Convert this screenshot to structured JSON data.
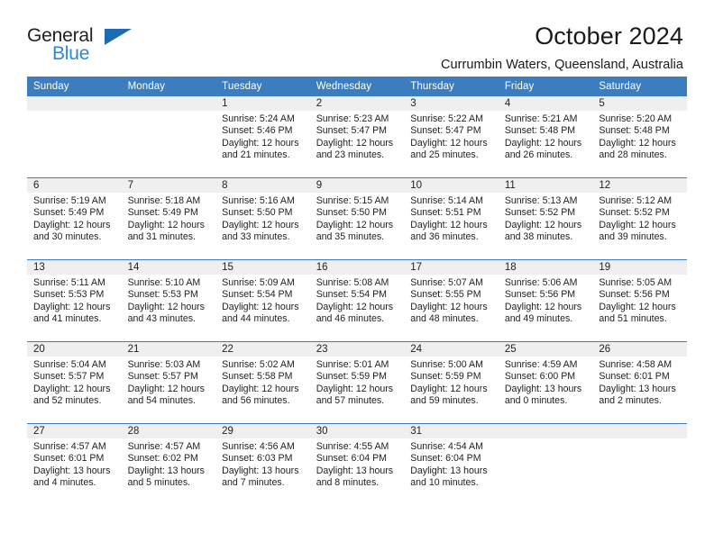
{
  "brand": {
    "name_part1": "General",
    "name_part2": "Blue",
    "triangle_icon": "triangle-icon",
    "accent_blue": "#2b8ad6",
    "dark_blue": "#1b6cb3"
  },
  "header": {
    "title": "October 2024",
    "subtitle": "Currumbin Waters, Queensland, Australia"
  },
  "theme": {
    "header_row_bg": "#3b7dbe",
    "day_band_bg": "#efefef",
    "grid_line": "#3b7dbe",
    "text": "#222222"
  },
  "weekday_headers": [
    "Sunday",
    "Monday",
    "Tuesday",
    "Wednesday",
    "Thursday",
    "Friday",
    "Saturday"
  ],
  "weeks": [
    [
      {
        "day": "",
        "sunrise": "",
        "sunset": "",
        "daylight_line1": "",
        "daylight_line2": ""
      },
      {
        "day": "",
        "sunrise": "",
        "sunset": "",
        "daylight_line1": "",
        "daylight_line2": ""
      },
      {
        "day": "1",
        "sunrise": "Sunrise: 5:24 AM",
        "sunset": "Sunset: 5:46 PM",
        "daylight_line1": "Daylight: 12 hours",
        "daylight_line2": "and 21 minutes."
      },
      {
        "day": "2",
        "sunrise": "Sunrise: 5:23 AM",
        "sunset": "Sunset: 5:47 PM",
        "daylight_line1": "Daylight: 12 hours",
        "daylight_line2": "and 23 minutes."
      },
      {
        "day": "3",
        "sunrise": "Sunrise: 5:22 AM",
        "sunset": "Sunset: 5:47 PM",
        "daylight_line1": "Daylight: 12 hours",
        "daylight_line2": "and 25 minutes."
      },
      {
        "day": "4",
        "sunrise": "Sunrise: 5:21 AM",
        "sunset": "Sunset: 5:48 PM",
        "daylight_line1": "Daylight: 12 hours",
        "daylight_line2": "and 26 minutes."
      },
      {
        "day": "5",
        "sunrise": "Sunrise: 5:20 AM",
        "sunset": "Sunset: 5:48 PM",
        "daylight_line1": "Daylight: 12 hours",
        "daylight_line2": "and 28 minutes."
      }
    ],
    [
      {
        "day": "6",
        "sunrise": "Sunrise: 5:19 AM",
        "sunset": "Sunset: 5:49 PM",
        "daylight_line1": "Daylight: 12 hours",
        "daylight_line2": "and 30 minutes."
      },
      {
        "day": "7",
        "sunrise": "Sunrise: 5:18 AM",
        "sunset": "Sunset: 5:49 PM",
        "daylight_line1": "Daylight: 12 hours",
        "daylight_line2": "and 31 minutes."
      },
      {
        "day": "8",
        "sunrise": "Sunrise: 5:16 AM",
        "sunset": "Sunset: 5:50 PM",
        "daylight_line1": "Daylight: 12 hours",
        "daylight_line2": "and 33 minutes."
      },
      {
        "day": "9",
        "sunrise": "Sunrise: 5:15 AM",
        "sunset": "Sunset: 5:50 PM",
        "daylight_line1": "Daylight: 12 hours",
        "daylight_line2": "and 35 minutes."
      },
      {
        "day": "10",
        "sunrise": "Sunrise: 5:14 AM",
        "sunset": "Sunset: 5:51 PM",
        "daylight_line1": "Daylight: 12 hours",
        "daylight_line2": "and 36 minutes."
      },
      {
        "day": "11",
        "sunrise": "Sunrise: 5:13 AM",
        "sunset": "Sunset: 5:52 PM",
        "daylight_line1": "Daylight: 12 hours",
        "daylight_line2": "and 38 minutes."
      },
      {
        "day": "12",
        "sunrise": "Sunrise: 5:12 AM",
        "sunset": "Sunset: 5:52 PM",
        "daylight_line1": "Daylight: 12 hours",
        "daylight_line2": "and 39 minutes."
      }
    ],
    [
      {
        "day": "13",
        "sunrise": "Sunrise: 5:11 AM",
        "sunset": "Sunset: 5:53 PM",
        "daylight_line1": "Daylight: 12 hours",
        "daylight_line2": "and 41 minutes."
      },
      {
        "day": "14",
        "sunrise": "Sunrise: 5:10 AM",
        "sunset": "Sunset: 5:53 PM",
        "daylight_line1": "Daylight: 12 hours",
        "daylight_line2": "and 43 minutes."
      },
      {
        "day": "15",
        "sunrise": "Sunrise: 5:09 AM",
        "sunset": "Sunset: 5:54 PM",
        "daylight_line1": "Daylight: 12 hours",
        "daylight_line2": "and 44 minutes."
      },
      {
        "day": "16",
        "sunrise": "Sunrise: 5:08 AM",
        "sunset": "Sunset: 5:54 PM",
        "daylight_line1": "Daylight: 12 hours",
        "daylight_line2": "and 46 minutes."
      },
      {
        "day": "17",
        "sunrise": "Sunrise: 5:07 AM",
        "sunset": "Sunset: 5:55 PM",
        "daylight_line1": "Daylight: 12 hours",
        "daylight_line2": "and 48 minutes."
      },
      {
        "day": "18",
        "sunrise": "Sunrise: 5:06 AM",
        "sunset": "Sunset: 5:56 PM",
        "daylight_line1": "Daylight: 12 hours",
        "daylight_line2": "and 49 minutes."
      },
      {
        "day": "19",
        "sunrise": "Sunrise: 5:05 AM",
        "sunset": "Sunset: 5:56 PM",
        "daylight_line1": "Daylight: 12 hours",
        "daylight_line2": "and 51 minutes."
      }
    ],
    [
      {
        "day": "20",
        "sunrise": "Sunrise: 5:04 AM",
        "sunset": "Sunset: 5:57 PM",
        "daylight_line1": "Daylight: 12 hours",
        "daylight_line2": "and 52 minutes."
      },
      {
        "day": "21",
        "sunrise": "Sunrise: 5:03 AM",
        "sunset": "Sunset: 5:57 PM",
        "daylight_line1": "Daylight: 12 hours",
        "daylight_line2": "and 54 minutes."
      },
      {
        "day": "22",
        "sunrise": "Sunrise: 5:02 AM",
        "sunset": "Sunset: 5:58 PM",
        "daylight_line1": "Daylight: 12 hours",
        "daylight_line2": "and 56 minutes."
      },
      {
        "day": "23",
        "sunrise": "Sunrise: 5:01 AM",
        "sunset": "Sunset: 5:59 PM",
        "daylight_line1": "Daylight: 12 hours",
        "daylight_line2": "and 57 minutes."
      },
      {
        "day": "24",
        "sunrise": "Sunrise: 5:00 AM",
        "sunset": "Sunset: 5:59 PM",
        "daylight_line1": "Daylight: 12 hours",
        "daylight_line2": "and 59 minutes."
      },
      {
        "day": "25",
        "sunrise": "Sunrise: 4:59 AM",
        "sunset": "Sunset: 6:00 PM",
        "daylight_line1": "Daylight: 13 hours",
        "daylight_line2": "and 0 minutes."
      },
      {
        "day": "26",
        "sunrise": "Sunrise: 4:58 AM",
        "sunset": "Sunset: 6:01 PM",
        "daylight_line1": "Daylight: 13 hours",
        "daylight_line2": "and 2 minutes."
      }
    ],
    [
      {
        "day": "27",
        "sunrise": "Sunrise: 4:57 AM",
        "sunset": "Sunset: 6:01 PM",
        "daylight_line1": "Daylight: 13 hours",
        "daylight_line2": "and 4 minutes."
      },
      {
        "day": "28",
        "sunrise": "Sunrise: 4:57 AM",
        "sunset": "Sunset: 6:02 PM",
        "daylight_line1": "Daylight: 13 hours",
        "daylight_line2": "and 5 minutes."
      },
      {
        "day": "29",
        "sunrise": "Sunrise: 4:56 AM",
        "sunset": "Sunset: 6:03 PM",
        "daylight_line1": "Daylight: 13 hours",
        "daylight_line2": "and 7 minutes."
      },
      {
        "day": "30",
        "sunrise": "Sunrise: 4:55 AM",
        "sunset": "Sunset: 6:04 PM",
        "daylight_line1": "Daylight: 13 hours",
        "daylight_line2": "and 8 minutes."
      },
      {
        "day": "31",
        "sunrise": "Sunrise: 4:54 AM",
        "sunset": "Sunset: 6:04 PM",
        "daylight_line1": "Daylight: 13 hours",
        "daylight_line2": "and 10 minutes."
      },
      {
        "day": "",
        "sunrise": "",
        "sunset": "",
        "daylight_line1": "",
        "daylight_line2": ""
      },
      {
        "day": "",
        "sunrise": "",
        "sunset": "",
        "daylight_line1": "",
        "daylight_line2": ""
      }
    ]
  ]
}
